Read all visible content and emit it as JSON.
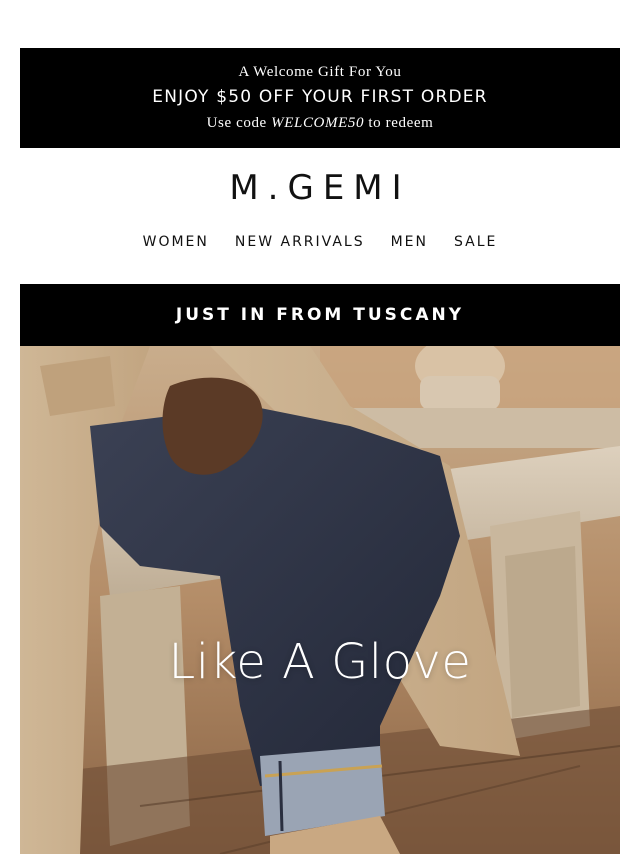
{
  "promo": {
    "gift_line": "A Welcome Gift For You",
    "offer_line": "ENJOY $50 OFF YOUR FIRST ORDER",
    "code_prefix": "Use code ",
    "code": "WELCOME50",
    "code_suffix": " to redeem"
  },
  "brand": {
    "logo": "M.GEMI"
  },
  "nav": {
    "items": [
      {
        "label": "WOMEN"
      },
      {
        "label": "NEW ARRIVALS"
      },
      {
        "label": "MEN"
      },
      {
        "label": "SALE"
      }
    ]
  },
  "banner": {
    "label": "JUST IN FROM TUSCANY"
  },
  "hero": {
    "headline": "Like A Glove",
    "image": "photo-person-seated-on-stone-bench-wearing-dark-jeans-and-camel-coat"
  },
  "colors": {
    "bar_background": "#000000",
    "bar_text": "#ffffff",
    "page_background": "#ffffff",
    "nav_text": "#111111"
  }
}
